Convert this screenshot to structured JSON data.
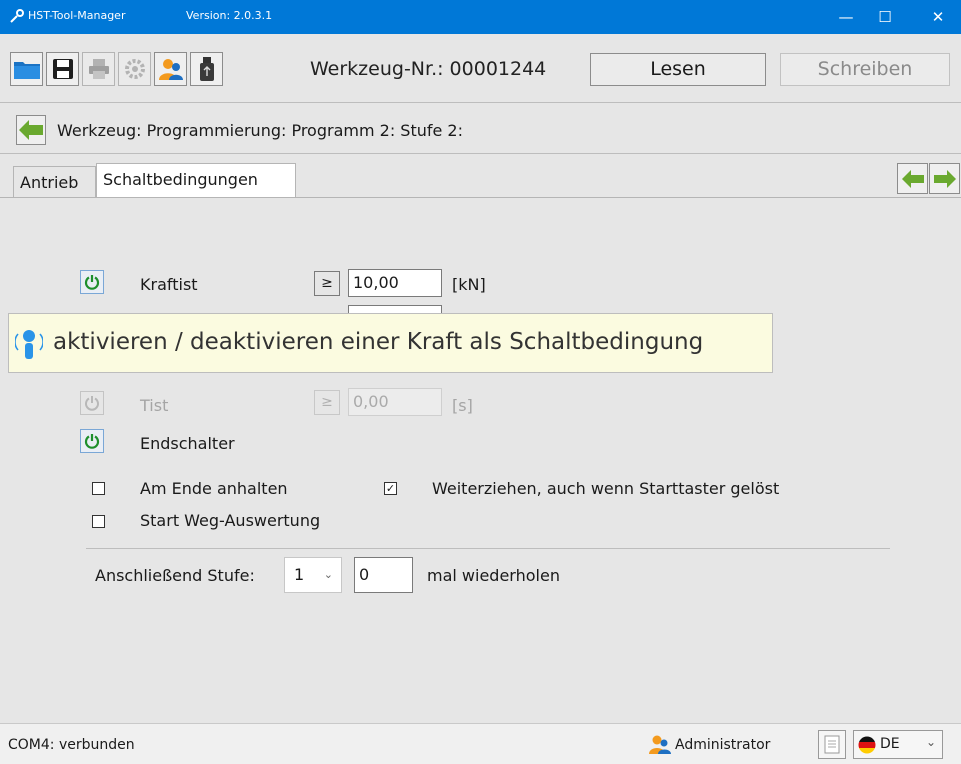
{
  "window": {
    "app_name": "HST-Tool-Manager",
    "version": "Version: 2.0.3.1",
    "minimize_glyph": "—",
    "maximize_glyph": "☐",
    "close_glyph": "✕",
    "accent": "#0078d7"
  },
  "toolbar": {
    "icons": [
      "folder-icon",
      "save-icon",
      "printer-icon",
      "gear-icon",
      "users-icon",
      "usb-stick-icon"
    ],
    "tool_number": "Werkzeug-Nr.: 00001244",
    "read_label": "Lesen",
    "write_label": "Schreiben"
  },
  "breadcrumb": {
    "path": "Werkzeug: Programmierung: Programm 2: Stufe 2:"
  },
  "tabs": [
    {
      "label": "Antrieb",
      "active": false
    },
    {
      "label": "Schaltbedingungen",
      "active": true
    }
  ],
  "conditions": {
    "kraft": {
      "label": "Kraftist",
      "operator": "≥",
      "value": "10,00",
      "unit": "[kN]",
      "enabled": true
    },
    "hidden": {
      "operator": "≥",
      "value": ""
    },
    "time": {
      "label": "Tist",
      "operator": "≥",
      "value": "0,00",
      "unit": "[s]",
      "enabled": false
    },
    "endschalter": {
      "label": "Endschalter",
      "enabled": true
    }
  },
  "tooltip": {
    "text": "aktivieren / deaktivieren einer Kraft als Schaltbedingung"
  },
  "options": {
    "stop_at_end": {
      "label": "Am Ende anhalten",
      "checked": false,
      "mark": ""
    },
    "keep_pulling": {
      "label": "Weiterziehen, auch wenn Starttaster gelöst",
      "checked": true,
      "mark": "✓"
    },
    "start_path_eval": {
      "label": "Start Weg-Auswertung",
      "checked": false,
      "mark": ""
    }
  },
  "followup": {
    "label": "Anschließend Stufe:",
    "stage_value": "1",
    "repeat_value": "0",
    "repeat_label": "mal wiederholen"
  },
  "status": {
    "connection": "COM4: verbunden",
    "user": "Administrator",
    "language": "DE",
    "language_chevron": "⌄"
  }
}
